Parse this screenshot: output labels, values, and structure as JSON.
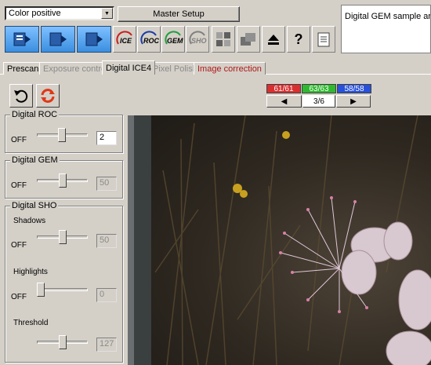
{
  "toolbar": {
    "mode_select": "Color positive",
    "master_setup": "Master Setup",
    "info_text": "Digital GEM sample area.",
    "buttons": [
      "ICE",
      "ROC",
      "GEM",
      "SHO"
    ]
  },
  "tabs": [
    "Prescan",
    "Exposure control",
    "Digital ICE4",
    "Pixel Polish",
    "Image correction"
  ],
  "counters": {
    "red": "61/61",
    "green": "63/63",
    "blue": "58/58",
    "red_color": "#d83030",
    "green_color": "#30b830",
    "blue_color": "#2850d8"
  },
  "nav": {
    "frame": "3/6"
  },
  "roc": {
    "title": "Digital ROC",
    "state": "OFF",
    "value": "2"
  },
  "gem": {
    "title": "Digital GEM",
    "state": "OFF",
    "value": "50"
  },
  "sho": {
    "title": "Digital SHO",
    "shadows_label": "Shadows",
    "shadows_state": "OFF",
    "shadows_value": "50",
    "highlights_label": "Highlights",
    "highlights_state": "OFF",
    "highlights_value": "0",
    "threshold_label": "Threshold",
    "threshold_value": "127"
  }
}
